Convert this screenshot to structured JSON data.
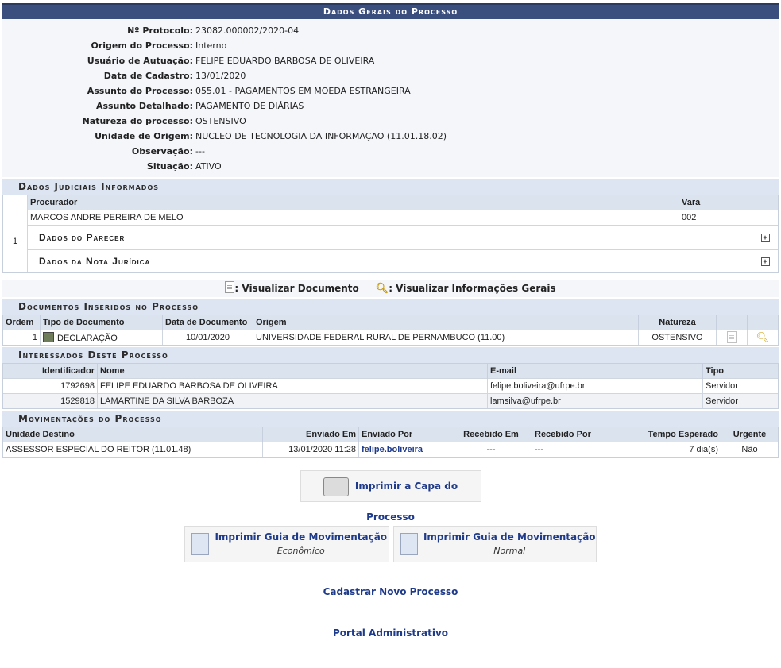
{
  "page_title": "Dados Gerais do Processo",
  "general": [
    {
      "label": "Nº Protocolo:",
      "value": "23082.000002/2020-04"
    },
    {
      "label": "Origem do Processo:",
      "value": "Interno"
    },
    {
      "label": "Usuário de Autuação:",
      "value": "FELIPE EDUARDO BARBOSA DE OLIVEIRA"
    },
    {
      "label": "Data de Cadastro:",
      "value": "13/01/2020"
    },
    {
      "label": "Assunto do Processo:",
      "value": "055.01 - PAGAMENTOS EM MOEDA ESTRANGEIRA"
    },
    {
      "label": "Assunto Detalhado:",
      "value": "PAGAMENTO DE DIÁRIAS"
    },
    {
      "label": "Natureza do processo:",
      "value": "OSTENSIVO"
    },
    {
      "label": "Unidade de Origem:",
      "value": "NUCLEO DE TECNOLOGIA DA INFORMAÇAO (11.01.18.02)"
    },
    {
      "label": "Observação:",
      "value": "---"
    },
    {
      "label": "Situação:",
      "value": "ATIVO"
    }
  ],
  "judicial": {
    "title": "Dados Judiciais Informados",
    "col_procurador": "Procurador",
    "col_vara": "Vara",
    "index": "1",
    "procurador": "MARCOS ANDRE PEREIRA DE MELO",
    "vara": "002",
    "parecer": "Dados do Parecer",
    "nota": "Dados da Nota Jurídica"
  },
  "legend": {
    "view_doc": ": Visualizar Documento",
    "view_info": ": Visualizar Informações Gerais"
  },
  "documents": {
    "title": "Documentos Inseridos no Processo",
    "headers": [
      "Ordem",
      "Tipo de Documento",
      "Data de Documento",
      "Origem",
      "Natureza"
    ],
    "rows": [
      {
        "ordem": "1",
        "tipo": "DECLARAÇÃO",
        "data": "10/01/2020",
        "origem": "UNIVERSIDADE FEDERAL RURAL DE PERNAMBUCO (11.00)",
        "natureza": "OSTENSIVO"
      }
    ]
  },
  "interessados": {
    "title": "Interessados Deste Processo",
    "headers": [
      "Identificador",
      "Nome",
      "E-mail",
      "Tipo"
    ],
    "rows": [
      {
        "id": "1792698",
        "nome": "FELIPE EDUARDO BARBOSA DE OLIVEIRA",
        "email": "felipe.boliveira@ufrpe.br",
        "tipo": "Servidor"
      },
      {
        "id": "1529818",
        "nome": "LAMARTINE DA SILVA BARBOZA",
        "email": "lamsilva@ufrpe.br",
        "tipo": "Servidor"
      }
    ]
  },
  "movimentacoes": {
    "title": "Movimentações do Processo",
    "headers": [
      "Unidade Destino",
      "Enviado Em",
      "Enviado Por",
      "Recebido Em",
      "Recebido Por",
      "Tempo Esperado",
      "Urgente"
    ],
    "rows": [
      {
        "destino": "ASSESSOR ESPECIAL DO REITOR (11.01.48)",
        "enviado_em": "13/01/2020 11:28",
        "enviado_por": "felipe.boliveira",
        "recebido_em": "---",
        "recebido_por": "---",
        "tempo": "7 dia(s)",
        "urgente": "Não"
      }
    ]
  },
  "actions": {
    "print_cover": "Imprimir a Capa do Processo",
    "guide_econ_title": "Imprimir Guia de Movimentação",
    "guide_econ_sub": "Econômico",
    "guide_norm_title": "Imprimir Guia de Movimentação",
    "guide_norm_sub": "Normal",
    "new_process": "Cadastrar Novo Processo",
    "portal": "Portal Administrativo"
  }
}
